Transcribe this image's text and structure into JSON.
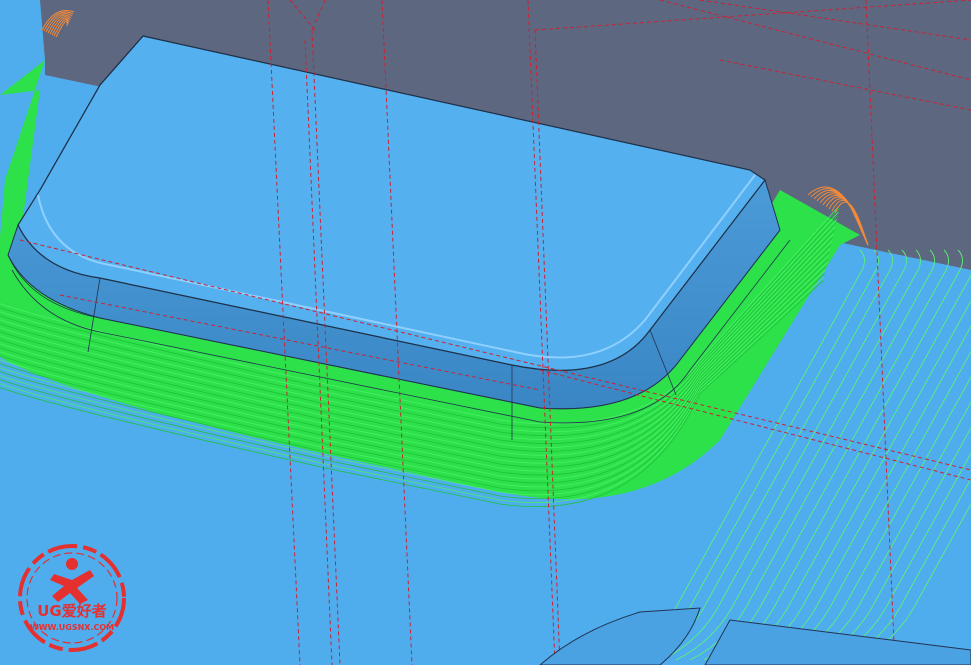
{
  "viewport": {
    "background_color": "#5d6780",
    "floor_color": "#4fadee",
    "part_top_color": "#55b0ef",
    "part_wall_color": "#3f8fcf",
    "toolpath_cut_color": "#22dd44",
    "toolpath_engage_color": "#f28a3a",
    "toolpath_rapid_color": "#cc2233"
  },
  "watermark": {
    "brand": "UG爱好者",
    "url": "WWW.UGSNX.COM",
    "color": "#e53030",
    "icon": "running-figure-icon"
  }
}
